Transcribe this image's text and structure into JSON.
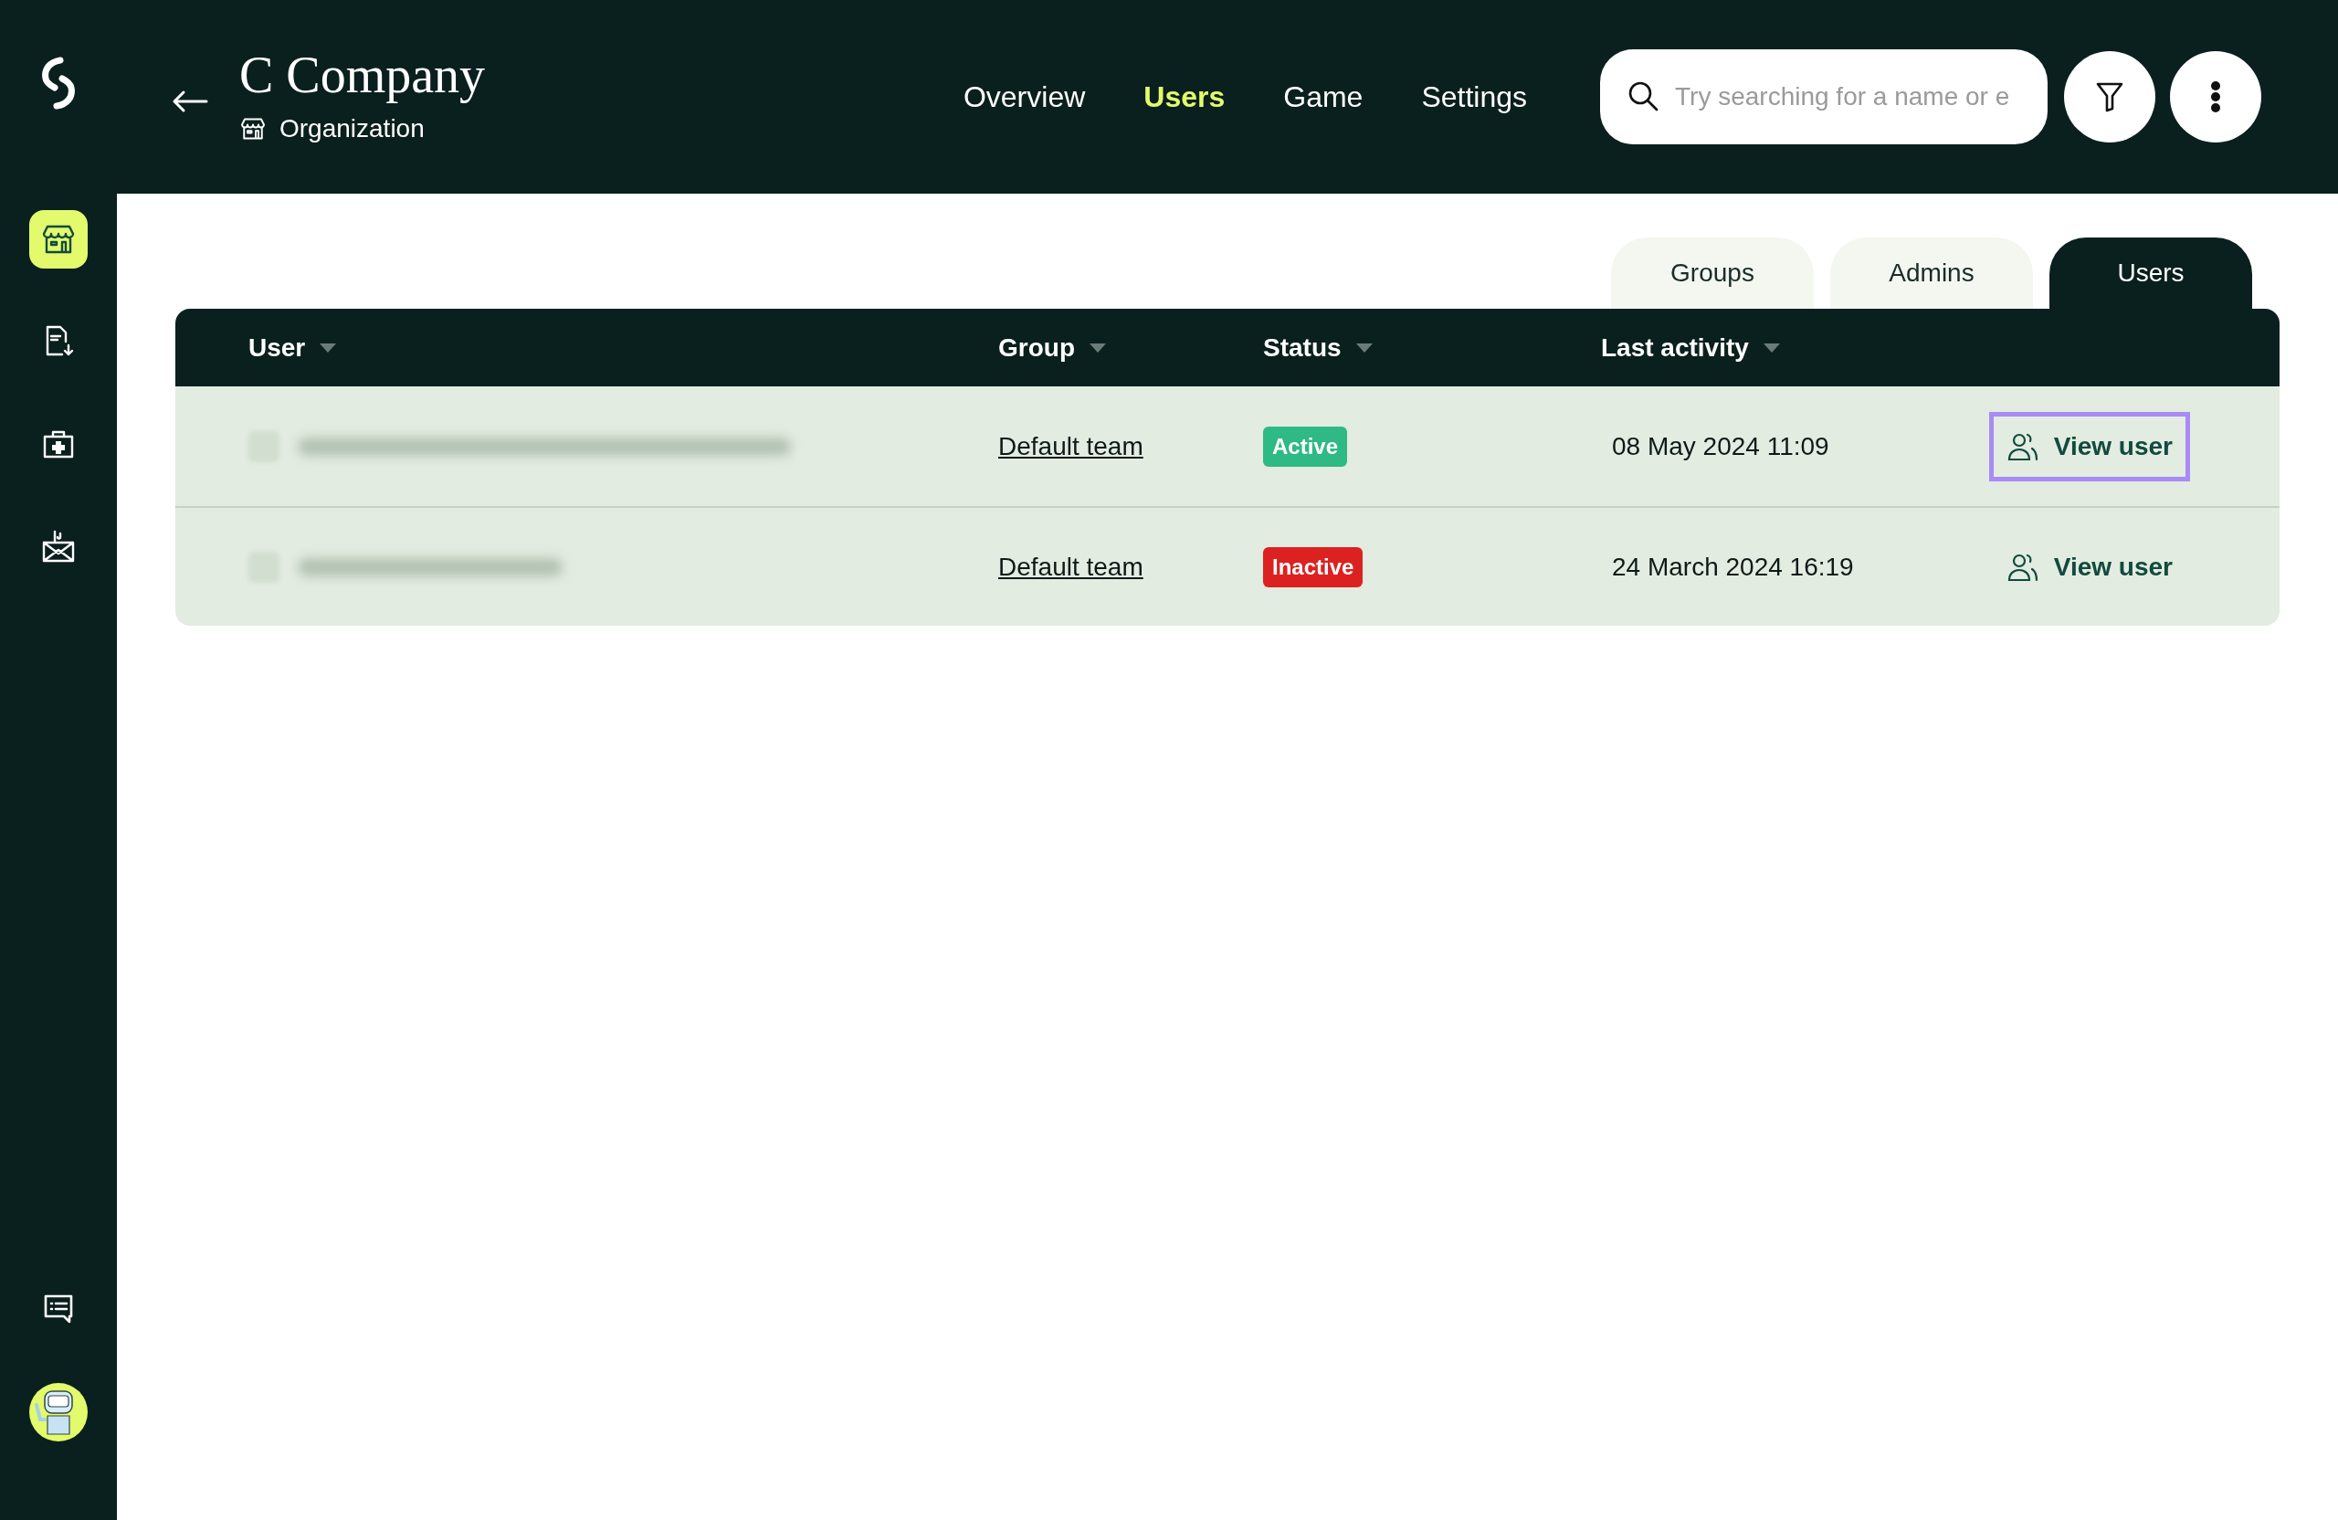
{
  "header": {
    "title": "C Company",
    "subtitle": "Organization",
    "nav": [
      {
        "label": "Overview",
        "selected": false
      },
      {
        "label": "Users",
        "selected": true
      },
      {
        "label": "Game",
        "selected": false
      },
      {
        "label": "Settings",
        "selected": false
      }
    ],
    "search": {
      "placeholder": "Try searching for a name or e"
    }
  },
  "sidebar": {
    "items": [
      {
        "selected": true
      },
      {
        "selected": false
      },
      {
        "selected": false
      },
      {
        "selected": false
      }
    ]
  },
  "tabs": [
    {
      "label": "Groups",
      "selected": false
    },
    {
      "label": "Admins",
      "selected": false
    },
    {
      "label": "Users",
      "selected": true
    }
  ],
  "table": {
    "columns": [
      "User",
      "Group",
      "Status",
      "Last activity"
    ],
    "rows": [
      {
        "checked": false,
        "group": "Default team",
        "status": {
          "label": "Active",
          "kind": "active"
        },
        "last_activity": "08 May 2024 11:09",
        "action": "View user",
        "focused": true
      },
      {
        "checked": false,
        "group": "Default team",
        "status": {
          "label": "Inactive",
          "kind": "inactive"
        },
        "last_activity": "24 March 2024 16:19",
        "action": "View user",
        "focused": false
      }
    ]
  }
}
